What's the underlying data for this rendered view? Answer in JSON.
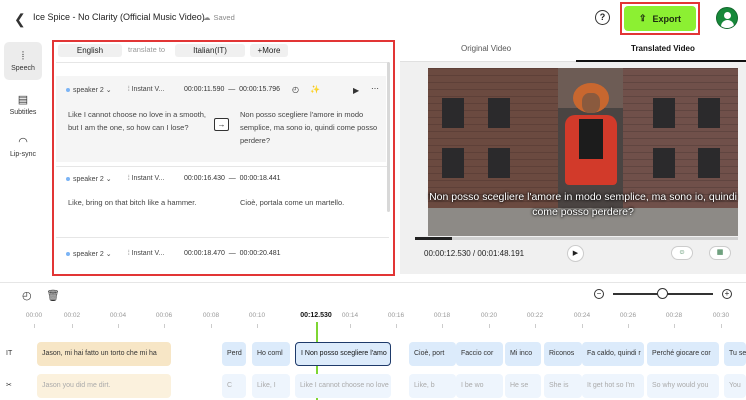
{
  "header": {
    "title": "Ice Spice - No Clarity (Official Music Video)",
    "saved": "Saved",
    "help": "?",
    "export_label": "Export"
  },
  "rail": {
    "items": [
      {
        "label": "Speech",
        "icon": "waveform-icon",
        "glyph": "⦙"
      },
      {
        "label": "Subtitles",
        "icon": "subtitles-icon",
        "glyph": "▤"
      },
      {
        "label": "Lip-sync",
        "icon": "lips-icon",
        "glyph": "◠"
      }
    ]
  },
  "editor": {
    "source_lang": "English",
    "translate_to": "translate to",
    "target_lang": "Italian(IT)",
    "more_label": "+More",
    "segments": [
      {
        "speaker": "speaker 2",
        "voice": "Instant V...",
        "start": "00:00:11.590",
        "end": "00:00:15.796",
        "source": "Like I cannot choose no love in a smooth, but I am the one, so how can I lose?",
        "target": "Non posso scegliere l'amore in modo semplice, ma sono io, quindi come posso perdere?"
      },
      {
        "speaker": "speaker 2",
        "voice": "Instant V...",
        "start": "00:00:16.430",
        "end": "00:00:18.441",
        "source": "Like, bring on that bitch like a hammer.",
        "target": "Cioè, portala come un martello."
      },
      {
        "speaker": "speaker 2",
        "voice": "Instant V...",
        "start": "00:00:18.470",
        "end": "00:00:20.481",
        "source": "",
        "target": ""
      }
    ],
    "dash": "—"
  },
  "video": {
    "tab_original": "Original Video",
    "tab_translated": "Translated Video",
    "subtitle": "Non posso scegliere l'amore in modo semplice, ma sono io, quindi come posso perdere?",
    "time": "00:00:12.530 / 00:01:48.191",
    "progress": 0.116
  },
  "timeline": {
    "ticks": [
      "00:00",
      "00:02",
      "00:04",
      "00:06",
      "00:08",
      "00:10",
      "00:12.530",
      "00:14",
      "00:16",
      "00:18",
      "00:20",
      "00:22",
      "00:24",
      "00:26",
      "00:28",
      "00:30"
    ],
    "track_translated_label": "IT",
    "translated_clips": [
      "Jason, mi hai fatto un torto che mi ha",
      "Perd",
      "Ho coml",
      "I Non posso scegliere l'amo",
      "Cioè, port",
      "Faccio cor",
      "Mi inco",
      "Riconos",
      "Fa caldo, quindi r",
      "Perché giocare cor",
      "Tu sei"
    ],
    "source_clips": [
      "Jason you did me dirt.",
      "C",
      "Like, I",
      "Like I cannot choose no love in a",
      "Like, b",
      "I be wo",
      "He se",
      "She is",
      "It get hot so I'm",
      "So why would you",
      "You"
    ]
  },
  "colors": {
    "accent": "#8cf032",
    "highlight_frame": "#e23535",
    "playhead": "#7ed633",
    "avatar": "#17893a"
  }
}
